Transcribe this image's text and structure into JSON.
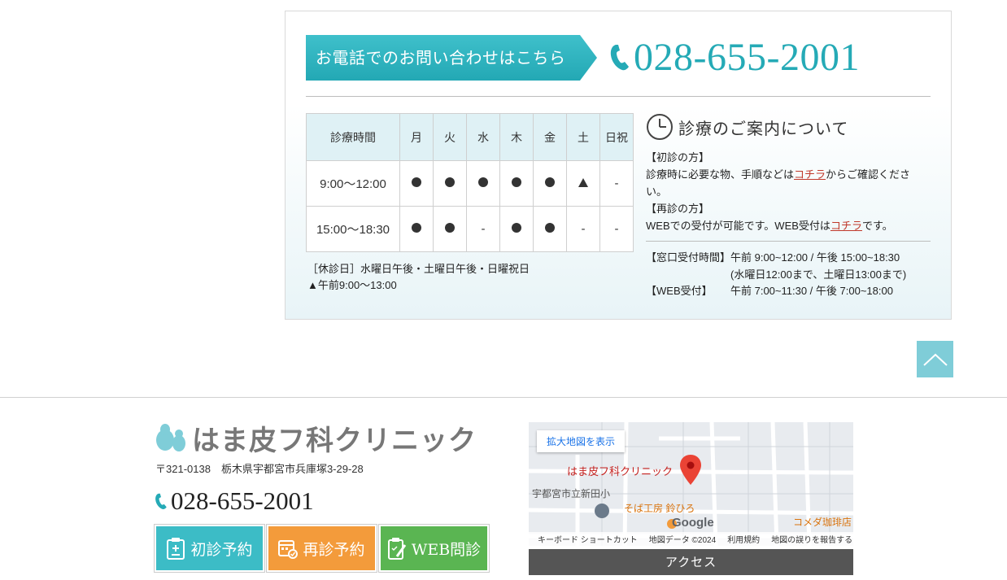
{
  "contact": {
    "ribbon_text": "お電話でのお問い合わせはこちら",
    "phone": "028-655-2001"
  },
  "hours_table": {
    "header": [
      "診療時間",
      "月",
      "火",
      "水",
      "木",
      "金",
      "土",
      "日祝"
    ],
    "rows": [
      {
        "time": "9:00～12:00",
        "marks": [
          "dot",
          "dot",
          "dot",
          "dot",
          "dot",
          "tri",
          "-"
        ]
      },
      {
        "time": "15:00～18:30",
        "marks": [
          "dot",
          "dot",
          "-",
          "dot",
          "dot",
          "-",
          "-"
        ]
      }
    ],
    "note_closed": "［休診日］水曜日午後・土曜日午後・日曜祝日",
    "note_triangle": "▲午前9:00～13:00"
  },
  "guide": {
    "title": "診療のご案内について",
    "first_visit_head": "【初診の方】",
    "first_visit_text_before": "診療時に必要な物、手順などは",
    "first_visit_link": "コチラ",
    "first_visit_text_after": "からご確認ください。",
    "revisit_head": "【再診の方】",
    "revisit_text_before": "WEBでの受付が可能です。WEB受付は",
    "revisit_link": "コチラ",
    "revisit_text_after": "です。",
    "window_label": "【窓口受付時間】",
    "window_hours": "午前 9:00~12:00 / 午後 15:00~18:30",
    "window_note": "(水曜日12:00まで、土曜日13:00まで)",
    "web_label": "【WEB受付】",
    "web_hours": "午前 7:00~11:30 / 午後 7:00~18:00"
  },
  "footer": {
    "clinic_name": "はま皮フ科クリニック",
    "address": "〒321-0138　栃木県宇都宮市兵庫塚3-29-28",
    "phone": "028-655-2001",
    "buttons": {
      "first": "初診予約",
      "revisit": "再診予約",
      "web": "WEB問診"
    }
  },
  "map": {
    "enlarge_link": "拡大地図を表示",
    "clinic_label": "はま皮フ科クリニック",
    "school_label": "宇都宮市立新田小",
    "soba_label": "そば工房 鈴ひろ",
    "komeda_label": "コメダ珈琲店",
    "google_label": "Google",
    "footer_items": [
      "キーボード ショートカット",
      "地図データ ©2024",
      "利用規約",
      "地図の誤りを報告する"
    ],
    "access_label": "アクセス"
  },
  "colors": {
    "accent": "#25aab6",
    "ribbon": "#2fb4bf",
    "btn_teal": "#3cbcc6",
    "btn_orange": "#f39b3b",
    "btn_green": "#5ab552"
  }
}
